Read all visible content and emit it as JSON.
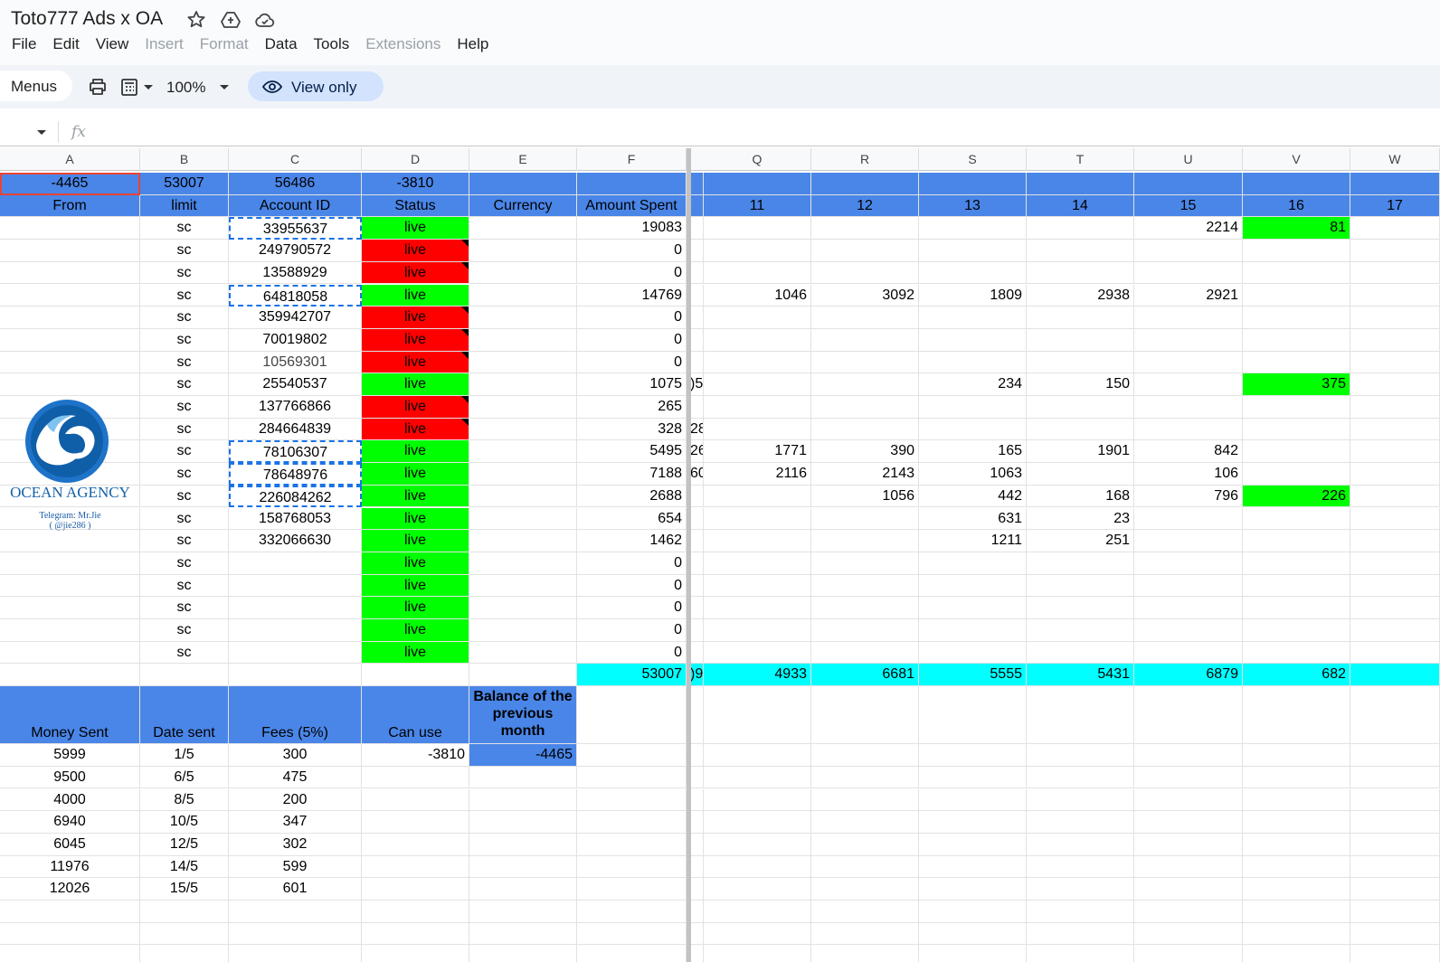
{
  "doc": {
    "title": "Toto777 Ads x OA"
  },
  "menu": [
    "File",
    "Edit",
    "View",
    "Insert",
    "Format",
    "Data",
    "Tools",
    "Extensions",
    "Help"
  ],
  "menu_disabled": [
    "Insert",
    "Format",
    "Extensions"
  ],
  "toolbar": {
    "menus_label": "Menus",
    "zoom": "100%",
    "view_only_label": "View only"
  },
  "formula_bar": {
    "fx": "fx",
    "value": ""
  },
  "columns": [
    "A",
    "B",
    "C",
    "D",
    "E",
    "F",
    "Q",
    "R",
    "S",
    "T",
    "U",
    "V",
    "W"
  ],
  "totals_row": {
    "A": "-4465",
    "B": "53007",
    "C": "56486",
    "D": "-3810"
  },
  "header_row": {
    "A": "From",
    "B": "limit",
    "C": "Account ID",
    "D": "Status",
    "E": "Currency",
    "F": "Amount Spent",
    "days": [
      "11",
      "12",
      "13",
      "14",
      "15",
      "16",
      "17"
    ]
  },
  "accounts": [
    {
      "limit": "sc",
      "id": "33955637",
      "status": "live",
      "state": "green",
      "spent": "19083",
      "stub": "",
      "days": [
        "",
        "",
        "",
        "",
        "2214",
        "81"
      ],
      "hl": [
        5
      ]
    },
    {
      "limit": "sc",
      "id": "249790572",
      "status": "live",
      "state": "red",
      "spent": "0",
      "stub": "",
      "days": [
        "",
        "",
        "",
        "",
        "",
        ""
      ],
      "hl": []
    },
    {
      "limit": "sc",
      "id": "13588929",
      "status": "live",
      "state": "red",
      "spent": "0",
      "stub": "",
      "days": [
        "",
        "",
        "",
        "",
        "",
        ""
      ],
      "hl": []
    },
    {
      "limit": "sc",
      "id": "64818058",
      "status": "live",
      "state": "green",
      "spent": "14769",
      "stub": "",
      "days": [
        "1046",
        "3092",
        "1809",
        "2938",
        "2921",
        ""
      ],
      "hl": []
    },
    {
      "limit": "sc",
      "id": "359942707",
      "status": "live",
      "state": "red",
      "spent": "0",
      "stub": "",
      "days": [
        "",
        "",
        "",
        "",
        "",
        ""
      ],
      "hl": []
    },
    {
      "limit": "sc",
      "id": "70019802",
      "status": "live",
      "state": "red",
      "spent": "0",
      "stub": "",
      "days": [
        "",
        "",
        "",
        "",
        "",
        ""
      ],
      "hl": []
    },
    {
      "limit": "sc",
      "id": "10569301",
      "status": "live",
      "state": "red",
      "spent": "0",
      "stub": "",
      "days": [
        "",
        "",
        "",
        "",
        "",
        ""
      ],
      "hl": []
    },
    {
      "limit": "sc",
      "id": "25540537",
      "status": "live",
      "state": "green",
      "spent": "1075",
      "stub": ")5",
      "days": [
        "",
        "",
        "234",
        "150",
        "",
        "375"
      ],
      "hl": [
        5
      ]
    },
    {
      "limit": "sc",
      "id": "137766866",
      "status": "live",
      "state": "red",
      "spent": "265",
      "stub": "",
      "days": [
        "",
        "",
        "",
        "",
        "",
        ""
      ],
      "hl": []
    },
    {
      "limit": "sc",
      "id": "284664839",
      "status": "live",
      "state": "red",
      "spent": "328",
      "stub": "28",
      "days": [
        "",
        "",
        "",
        "",
        "",
        ""
      ],
      "hl": []
    },
    {
      "limit": "sc",
      "id": "78106307",
      "status": "live",
      "state": "green",
      "spent": "5495",
      "stub": "26",
      "days": [
        "1771",
        "390",
        "165",
        "1901",
        "842",
        ""
      ],
      "hl": []
    },
    {
      "limit": "sc",
      "id": "78648976",
      "status": "live",
      "state": "green",
      "spent": "7188",
      "stub": "60",
      "days": [
        "2116",
        "2143",
        "1063",
        "",
        "106",
        ""
      ],
      "hl": []
    },
    {
      "limit": "sc",
      "id": "226084262",
      "status": "live",
      "state": "green",
      "spent": "2688",
      "stub": "",
      "days": [
        "",
        "1056",
        "442",
        "168",
        "796",
        "226"
      ],
      "hl": [
        5
      ]
    },
    {
      "limit": "sc",
      "id": "158768053",
      "status": "live",
      "state": "green",
      "spent": "654",
      "stub": "",
      "days": [
        "",
        "",
        "631",
        "23",
        "",
        ""
      ],
      "hl": []
    },
    {
      "limit": "sc",
      "id": "332066630",
      "status": "live",
      "state": "green",
      "spent": "1462",
      "stub": "",
      "days": [
        "",
        "",
        "1211",
        "251",
        "",
        ""
      ],
      "hl": []
    },
    {
      "limit": "sc",
      "id": "",
      "status": "live",
      "state": "green",
      "spent": "0",
      "stub": "",
      "days": [
        "",
        "",
        "",
        "",
        "",
        ""
      ],
      "hl": []
    },
    {
      "limit": "sc",
      "id": "",
      "status": "live",
      "state": "green",
      "spent": "0",
      "stub": "",
      "days": [
        "",
        "",
        "",
        "",
        "",
        ""
      ],
      "hl": []
    },
    {
      "limit": "sc",
      "id": "",
      "status": "live",
      "state": "green",
      "spent": "0",
      "stub": "",
      "days": [
        "",
        "",
        "",
        "",
        "",
        ""
      ],
      "hl": []
    },
    {
      "limit": "sc",
      "id": "",
      "status": "live",
      "state": "green",
      "spent": "0",
      "stub": "",
      "days": [
        "",
        "",
        "",
        "",
        "",
        ""
      ],
      "hl": []
    },
    {
      "limit": "sc",
      "id": "",
      "status": "live",
      "state": "green",
      "spent": "0",
      "stub": "",
      "days": [
        "",
        "",
        "",
        "",
        "",
        ""
      ],
      "hl": []
    }
  ],
  "spend_totals": {
    "F": "53007",
    "stub": ")9",
    "days": [
      "4933",
      "6681",
      "5555",
      "5431",
      "6879",
      "682"
    ]
  },
  "payments_header": {
    "money_sent": "Money Sent",
    "date_sent": "Date sent",
    "fees": "Fees (5%)",
    "can_use": "Can use",
    "balance": "Balance of the previous month"
  },
  "payments": [
    {
      "money": "5999",
      "date": "1/5",
      "fee": "300"
    },
    {
      "money": "9500",
      "date": "6/5",
      "fee": "475"
    },
    {
      "money": "4000",
      "date": "8/5",
      "fee": "200"
    },
    {
      "money": "6940",
      "date": "10/5",
      "fee": "347"
    },
    {
      "money": "6045",
      "date": "12/5",
      "fee": "302"
    },
    {
      "money": "11976",
      "date": "14/5",
      "fee": "599"
    },
    {
      "money": "12026",
      "date": "15/5",
      "fee": "601"
    }
  ],
  "can_use_value": "-3810",
  "balance_value": "-4465",
  "logo": {
    "name": "OCEAN AGENCY",
    "line1": "Telegram: Mr.Jie",
    "line2": "( @jie286 )"
  },
  "colors": {
    "header_blue": "#4a86e8",
    "live_green": "#00ff00",
    "dead_red": "#ff0000",
    "total_cyan": "#00ffff"
  }
}
